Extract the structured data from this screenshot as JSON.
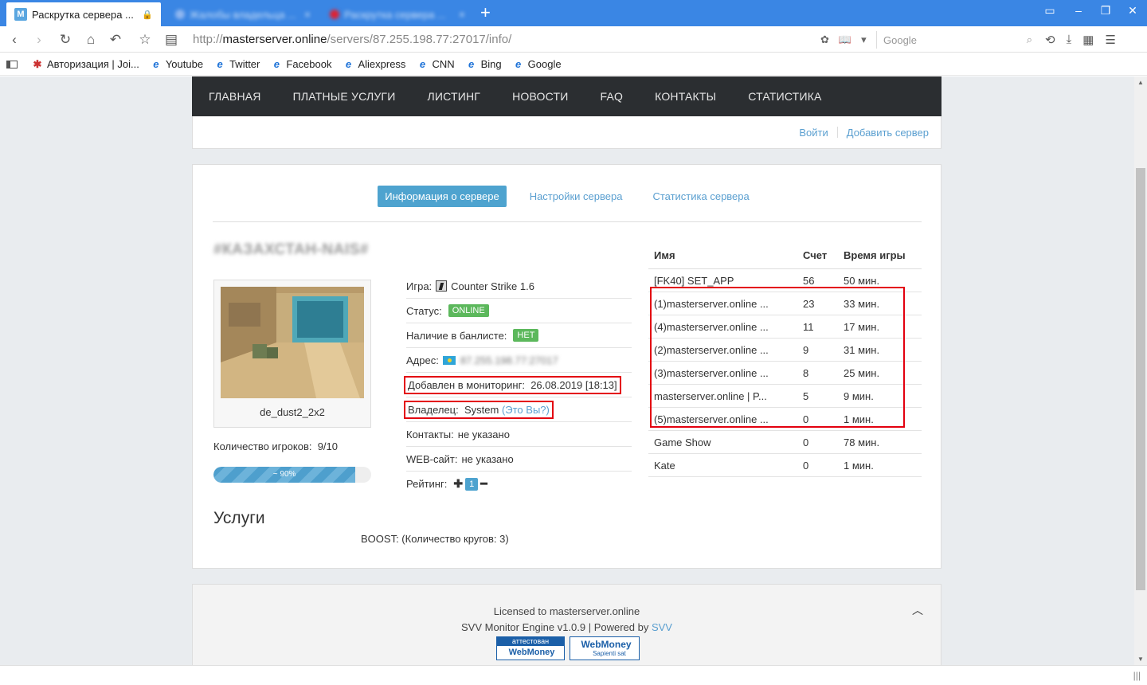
{
  "browser": {
    "tabs": [
      {
        "title": "Раскрутка сервера ...",
        "favicon": "M",
        "active": true
      },
      {
        "title": "Жалобы владельца ...",
        "active": false
      },
      {
        "title": "Раскрутка сервера ...",
        "active": false
      }
    ],
    "url_prefix": "http://",
    "url_host": "masterserver.online",
    "url_path": "/servers/87.255.198.77:27017/info/",
    "search_placeholder": "Google",
    "bookmarks": [
      {
        "label": "Авторизация | Joi...",
        "icon": "joomla-icon"
      },
      {
        "label": "Youtube",
        "icon": "ie-icon"
      },
      {
        "label": "Twitter",
        "icon": "ie-icon"
      },
      {
        "label": "Facebook",
        "icon": "ie-icon"
      },
      {
        "label": "Aliexpress",
        "icon": "ie-icon"
      },
      {
        "label": "CNN",
        "icon": "ie-icon"
      },
      {
        "label": "Bing",
        "icon": "ie-icon"
      },
      {
        "label": "Google",
        "icon": "ie-icon"
      }
    ]
  },
  "site": {
    "nav": [
      "ГЛАВНАЯ",
      "ПЛАТНЫЕ УСЛУГИ",
      "ЛИСТИНГ",
      "НОВОСТИ",
      "FAQ",
      "КОНТАКТЫ",
      "СТАТИСТИКА"
    ],
    "login": "Войти",
    "add_server": "Добавить сервер"
  },
  "server": {
    "tabs": [
      "Информация о сервере",
      "Настройки сервера",
      "Статистика сервера"
    ],
    "name": "#КАЗАХСТАН-NAIS#",
    "map": "de_dust2_2x2",
    "players_label": "Количество игроков:",
    "players_value": "9/10",
    "load_percent": 90,
    "load_label": "~ 90%",
    "info": {
      "game_label": "Игра:",
      "game_value": "Counter Strike 1.6",
      "status_label": "Статус:",
      "status_value": "ONLINE",
      "ban_label": "Наличие в банлисте:",
      "ban_value": "НЕТ",
      "address_label": "Адрес:",
      "address_value": "87.255.198.77:27017",
      "added_label": "Добавлен в мониторинг:",
      "added_value": "26.08.2019 [18:13]",
      "owner_label": "Владелец:",
      "owner_value": "System",
      "owner_link": "(Это Вы?)",
      "contacts_label": "Контакты:",
      "contacts_value": "не указано",
      "web_label": "WEB-сайт:",
      "web_value": "не указано",
      "rating_label": "Рейтинг:",
      "rating_value": "1"
    },
    "players_table": {
      "headers": [
        "Имя",
        "Счет",
        "Время игры"
      ],
      "rows": [
        [
          "[FK40] SET_APP",
          "56",
          "50 мин."
        ],
        [
          "(1)masterserver.online ...",
          "23",
          "33 мин."
        ],
        [
          "(4)masterserver.online ...",
          "11",
          "17 мин."
        ],
        [
          "(2)masterserver.online ...",
          "9",
          "31 мин."
        ],
        [
          "(3)masterserver.online ...",
          "8",
          "25 мин."
        ],
        [
          "masterserver.online | P...",
          "5",
          "9 мин."
        ],
        [
          "(5)masterserver.online ...",
          "0",
          "1 мин."
        ],
        [
          "Game Show",
          "0",
          "78 мин."
        ],
        [
          "Kate",
          "0",
          "1 мин."
        ]
      ]
    },
    "services_title": "Услуги",
    "services_line": "BOOST:   (Количество кругов: 3)"
  },
  "footer": {
    "licensed": "Licensed to masterserver.online",
    "engine": "SVV Monitor Engine v1.0.9 | Powered by ",
    "engine_link": "SVV",
    "wm1_top": "аттестован",
    "wm1_bottom": "WebMoney",
    "wm2_a": "WebMoney",
    "wm2_b": "Sapienti sat"
  }
}
